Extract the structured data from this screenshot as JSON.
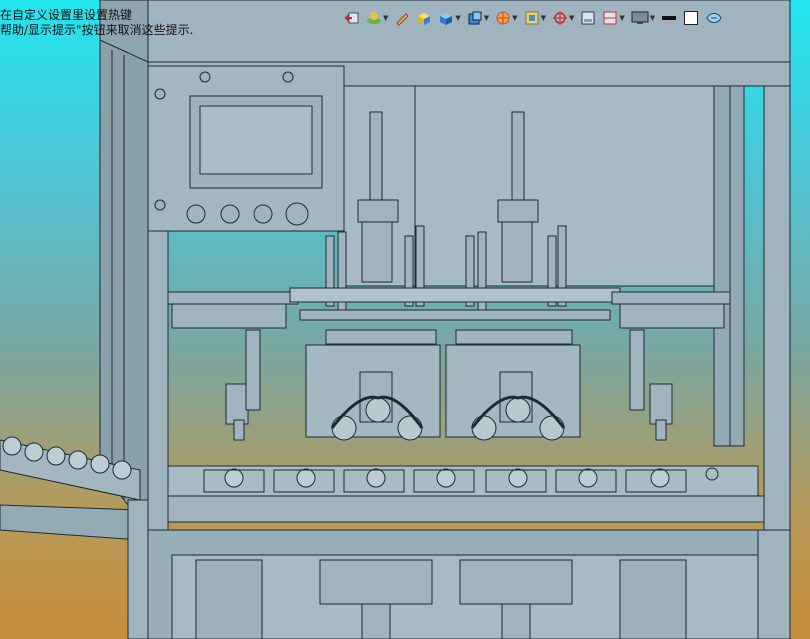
{
  "hint": {
    "line1": "在自定义设置里设置热键",
    "line2": "帮助/显示提示\"按钮来取消这些提示."
  },
  "toolbar": {
    "icons": [
      "previous-view-icon",
      "lighting-icon",
      "sketch-pencil-icon",
      "shaded-box-icon",
      "box-view-icon",
      "view-cube-icon",
      "appearance-sphere-icon",
      "section-view-icon",
      "view-origin-icon",
      "single-viewport-icon",
      "split-viewport-icon",
      "display-monitor-icon",
      "line-color-icon",
      "fill-color-icon",
      "display-style-icon"
    ]
  },
  "colors": {
    "model_fill": "#9fb4be",
    "model_line": "#1c2a33",
    "background_top": "#22e6f0",
    "background_bottom": "#c88d3a"
  }
}
